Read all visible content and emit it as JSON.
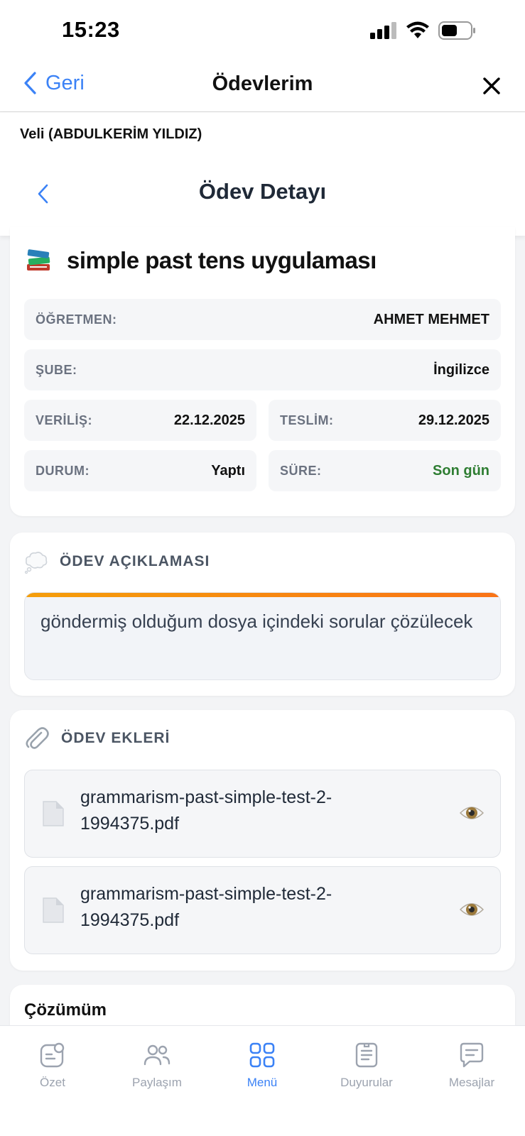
{
  "status": {
    "time": "15:23"
  },
  "nav": {
    "back_label": "Geri",
    "title": "Ödevlerim"
  },
  "user": {
    "label": "Veli (ABDULKERİM YILDIZ)"
  },
  "detail": {
    "title": "Ödev Detayı"
  },
  "homework": {
    "title": "simple past tens uygulaması",
    "icon": "books-icon",
    "fields": {
      "teacher_label": "ÖĞRETMEN:",
      "teacher_value": "AHMET MEHMET",
      "branch_label": "ŞUBE:",
      "branch_value": "İngilizce",
      "given_label": "VERİLİŞ:",
      "given_value": "22.12.2025",
      "due_label": "TESLİM:",
      "due_value": "29.12.2025",
      "status_label": "DURUM:",
      "status_value": "Yaptı",
      "time_label": "SÜRE:",
      "time_value": "Son gün"
    }
  },
  "description": {
    "section_title": "ÖDEV AÇIKLAMASI",
    "text": "göndermiş olduğum dosya içindeki sorular çözülecek"
  },
  "attachments": {
    "section_title": "ÖDEV EKLERİ",
    "files": [
      {
        "name": "grammarism-past-simple-test-2-1994375.pdf"
      },
      {
        "name": "grammarism-past-simple-test-2-1994375.pdf"
      }
    ]
  },
  "solution": {
    "title": "Çözümüm"
  },
  "tabs": [
    {
      "label": "Özet",
      "icon": "summary-icon"
    },
    {
      "label": "Paylaşım",
      "icon": "people-icon"
    },
    {
      "label": "Menü",
      "icon": "grid-icon"
    },
    {
      "label": "Duyurular",
      "icon": "document-icon"
    },
    {
      "label": "Mesajlar",
      "icon": "chat-icon"
    }
  ],
  "colors": {
    "accent": "#3b82f6",
    "green": "#2e7d32",
    "orange": "#f97316"
  }
}
